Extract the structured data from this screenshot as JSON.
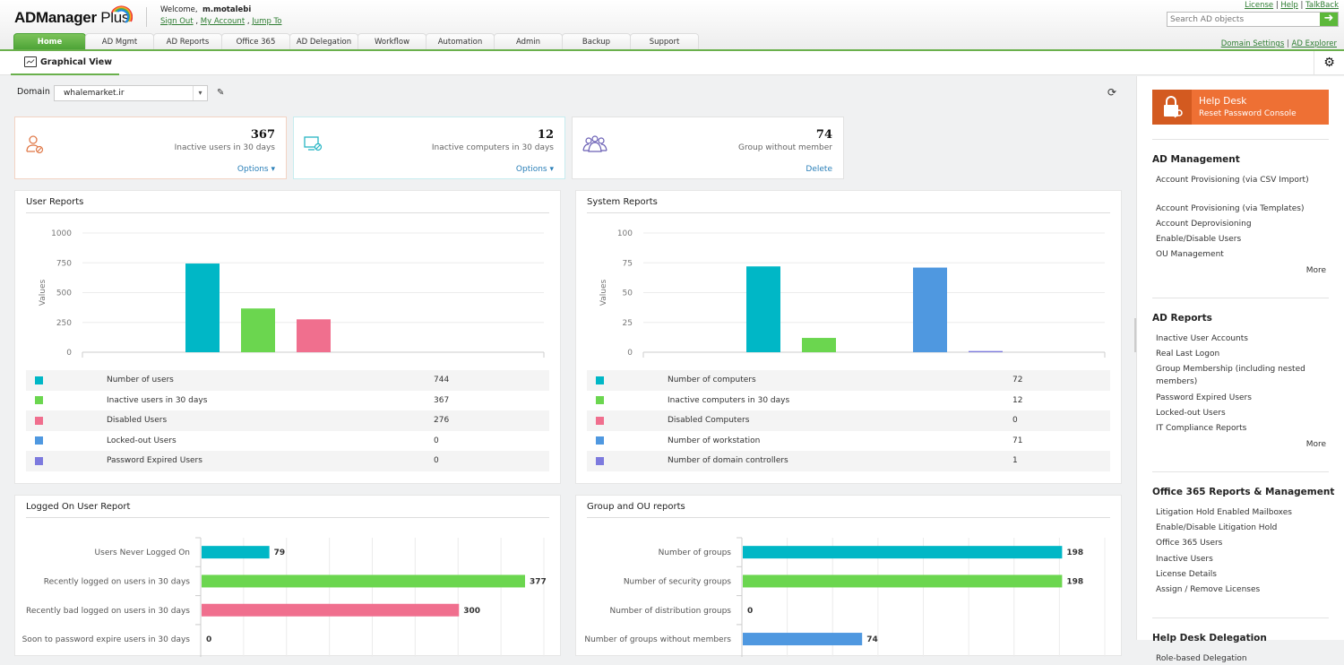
{
  "app": {
    "name_main": "ADManager",
    "name_plus": " Plus"
  },
  "welcome": {
    "prefix": "Welcome,",
    "user": "m.motalebi",
    "sign_out": "Sign Out",
    "my_account": "My Account",
    "jump_to": "Jump To",
    "sep": ","
  },
  "top_links": {
    "license": "License",
    "help": "Help",
    "talkback": "TalkBack"
  },
  "search": {
    "placeholder": "Search AD objects",
    "go_icon": "arrow-right-icon"
  },
  "tabs": [
    {
      "label": "Home",
      "active": true
    },
    {
      "label": "AD Mgmt"
    },
    {
      "label": "AD Reports"
    },
    {
      "label": "Office 365"
    },
    {
      "label": "AD Delegation"
    },
    {
      "label": "Workflow"
    },
    {
      "label": "Automation"
    },
    {
      "label": "Admin"
    },
    {
      "label": "Backup"
    },
    {
      "label": "Support"
    }
  ],
  "domain_links": {
    "domain_settings": "Domain Settings",
    "ad_explorer": "AD Explorer"
  },
  "subtab": {
    "label": "Graphical View"
  },
  "domain": {
    "label": "Domain",
    "value": "whalemarket.ir"
  },
  "cards": [
    {
      "value": "367",
      "desc": "Inactive users in 30 days",
      "action": "Options ▾",
      "icon": "user-inactive-icon",
      "color": "#e07a4a"
    },
    {
      "value": "12",
      "desc": "Inactive computers in 30 days",
      "action": "Options ▾",
      "icon": "computer-inactive-icon",
      "color": "#27b5c4"
    },
    {
      "value": "74",
      "desc": "Group without member",
      "action": "Delete",
      "icon": "group-icon",
      "color": "#6a5fb5"
    }
  ],
  "colors": {
    "teal": "#00b7c6",
    "green": "#6bd64f",
    "pink": "#f06f8e",
    "blue": "#4f98e0",
    "purple": "#7d7ade",
    "orange": "#ee7034"
  },
  "chart_data": [
    {
      "type": "bar",
      "title": "User Reports",
      "ylabel": "Values",
      "ylim": [
        0,
        1000
      ],
      "yticks": [
        0,
        250,
        500,
        750,
        1000
      ],
      "categories": [
        "Number of users",
        "Inactive users in 30 days",
        "Disabled Users",
        "Locked-out Users",
        "Password Expired Users"
      ],
      "values": [
        744,
        367,
        276,
        0,
        0
      ],
      "colors": [
        "#00b7c6",
        "#6bd64f",
        "#f06f8e",
        "#4f98e0",
        "#7d7ade"
      ]
    },
    {
      "type": "bar",
      "title": "System Reports",
      "ylabel": "Values",
      "ylim": [
        0,
        100
      ],
      "yticks": [
        0,
        25,
        50,
        75,
        100
      ],
      "categories": [
        "Number of computers",
        "Inactive computers in 30 days",
        "Disabled Computers",
        "Number of workstation",
        "Number of domain controllers"
      ],
      "values": [
        72,
        12,
        0,
        71,
        1
      ],
      "colors": [
        "#00b7c6",
        "#6bd64f",
        "#f06f8e",
        "#4f98e0",
        "#7d7ade"
      ]
    },
    {
      "type": "bar",
      "orientation": "horizontal",
      "title": "Logged On User Report",
      "xlim": [
        0,
        400
      ],
      "categories": [
        "Users Never Logged On",
        "Recently logged on users in 30 days",
        "Recently bad logged on users in 30 days",
        "Soon to password expire users in 30 days"
      ],
      "values": [
        79,
        377,
        300,
        0
      ],
      "colors": [
        "#00b7c6",
        "#6bd64f",
        "#f06f8e",
        "#4f98e0"
      ]
    },
    {
      "type": "bar",
      "orientation": "horizontal",
      "title": "Group and OU reports",
      "xlim": [
        0,
        225
      ],
      "categories": [
        "Number of groups",
        "Number of security groups",
        "Number of distribution groups",
        "Number of groups without members"
      ],
      "values": [
        198,
        198,
        0,
        74
      ],
      "colors": [
        "#00b7c6",
        "#6bd64f",
        "#f06f8e",
        "#4f98e0"
      ]
    }
  ],
  "sidebar": {
    "helpdesk": {
      "title": "Help Desk",
      "subtitle": "Reset Password Console"
    },
    "sections": [
      {
        "title": "AD Management",
        "items": [
          "Account Provisioning (via CSV Import)",
          "Account Provisioning (via Templates)",
          "Account Deprovisioning",
          "Enable/Disable Users",
          "OU Management"
        ],
        "more": "More"
      },
      {
        "title": "AD Reports",
        "items": [
          "Inactive User Accounts",
          "Real Last Logon",
          "Group Membership (including nested members)",
          "Password Expired Users",
          "Locked-out Users",
          "IT Compliance Reports"
        ],
        "more": "More"
      },
      {
        "title": "Office 365 Reports & Management",
        "items": [
          "Litigation Hold Enabled Mailboxes",
          "Enable/Disable Litigation Hold",
          "Office 365 Users",
          "Inactive Users",
          "License Details",
          "Assign / Remove Licenses"
        ]
      },
      {
        "title": "Help Desk Delegation",
        "items": [
          "Role-based Delegation"
        ]
      }
    ]
  }
}
